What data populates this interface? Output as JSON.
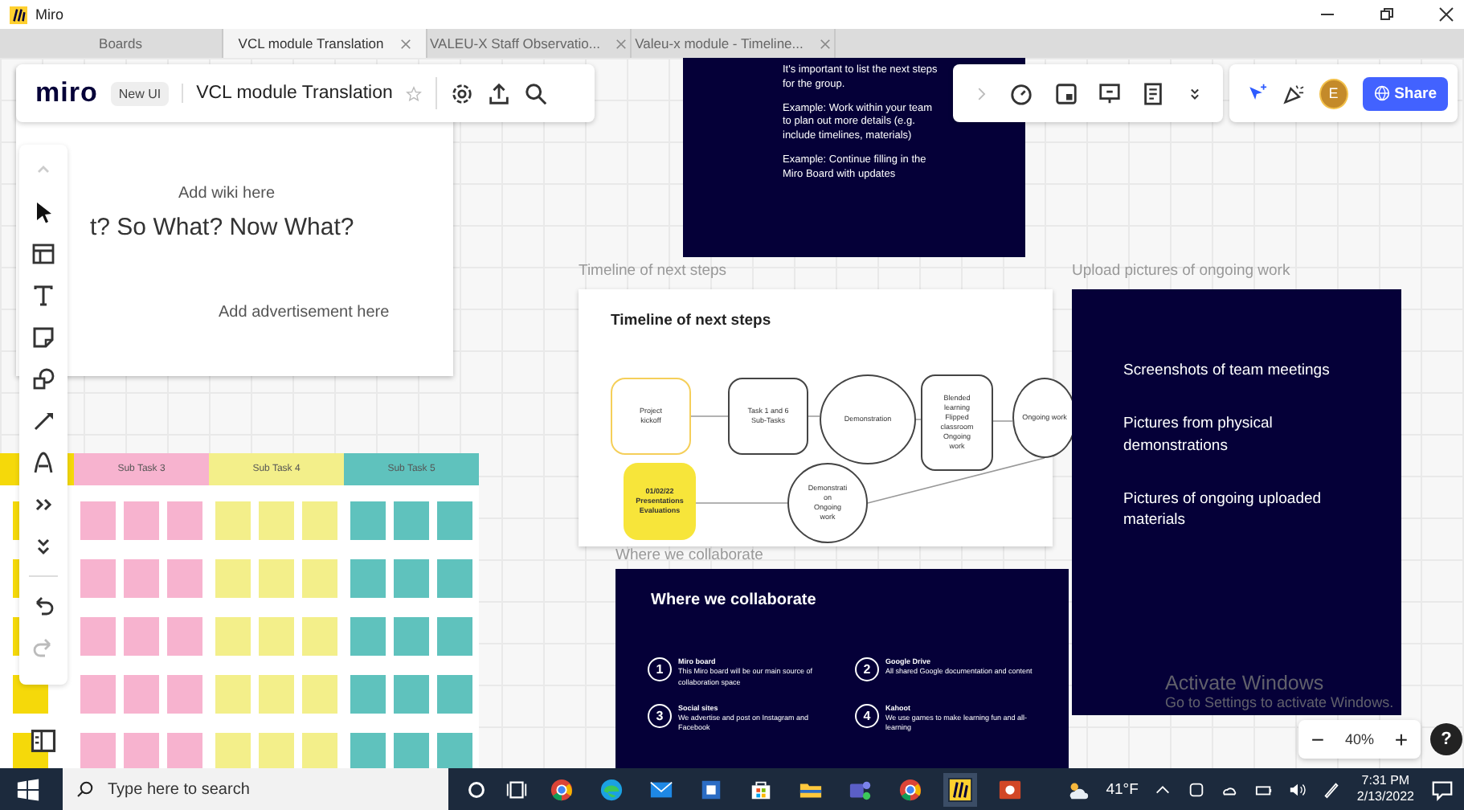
{
  "window": {
    "title": "Miro"
  },
  "tabs": [
    {
      "label": "Boards",
      "selected": false
    },
    {
      "label": "VCL module Translation",
      "selected": true
    },
    {
      "label": "VALEU-X Staff Observatio...",
      "selected": false
    },
    {
      "label": "Valeu-x module - Timeline...",
      "selected": false
    }
  ],
  "board_bar": {
    "logo": "miro",
    "badge": "New UI",
    "board_name": "VCL module Translation",
    "avatar": "E",
    "share": "Share"
  },
  "wiki_card": {
    "wiki": "Add wiki here",
    "heading": "t? So What? Now What?",
    "ad": "Add advertisement here"
  },
  "notes_card": {
    "lines": [
      "It's important to list the next steps for the group.",
      "Example: Work within your team to plan out more details (e.g. include timelines, materials)",
      "Example: Continue filling in the Miro Board with updates"
    ]
  },
  "timeline": {
    "label": "Timeline of next steps",
    "title": "Timeline of next steps",
    "nodes": [
      {
        "kind": "outlined",
        "lines": [
          "Project",
          "kickoff"
        ]
      },
      {
        "kind": "rounded",
        "lines": [
          "Task 1 and 6",
          "Sub-Tasks"
        ]
      },
      {
        "kind": "circle",
        "lines": [
          "Demonstration"
        ]
      },
      {
        "kind": "rounded",
        "lines": [
          "Blended",
          "learning",
          "Flipped",
          "classroom",
          "Ongoing",
          "work"
        ]
      },
      {
        "kind": "circle",
        "lines": [
          "Ongoing work"
        ]
      },
      {
        "kind": "highlight",
        "lines": [
          "01/02/22",
          "Presentations",
          "Evaluations"
        ]
      },
      {
        "kind": "circle",
        "lines": [
          "Demonstrati",
          "on",
          "Ongoing",
          "work"
        ]
      }
    ]
  },
  "uploads": {
    "label": "Upload pictures of ongoing work",
    "items": [
      "Screenshots of team meetings",
      "Pictures from physical demonstrations",
      "Pictures of ongoing uploaded materials"
    ]
  },
  "collab": {
    "label": "Where we collaborate",
    "title": "Where we collaborate",
    "items": [
      {
        "number": "1",
        "name": "Miro board",
        "text": "This Miro board will be our main source of collaboration space"
      },
      {
        "number": "2",
        "name": "Google Drive",
        "text": "All shared Google documentation and content"
      },
      {
        "number": "3",
        "name": "Social sites",
        "text": "We advertise and post on Instagram and Facebook"
      },
      {
        "number": "4",
        "name": "Kahoot",
        "text": "We use games to make learning fun and all-learning"
      }
    ]
  },
  "sticky_columns": [
    {
      "color": "#f5d90a"
    },
    {
      "header": "Sub Task 3",
      "color": "#f7b3cf"
    },
    {
      "header": "Sub Task 4",
      "color": "#f3ef8a"
    },
    {
      "header": "Sub Task 5",
      "color": "#5fc2bd"
    }
  ],
  "zoom": {
    "minus": "−",
    "level": "40%",
    "plus": "+",
    "help": "?"
  },
  "activation": {
    "title": "Activate Windows",
    "hint": "Go to Settings to activate Windows."
  },
  "taskbar": {
    "search_placeholder": "Type here to search",
    "weather": "41°F",
    "time": "7:31 PM",
    "date": "2/13/2022"
  }
}
